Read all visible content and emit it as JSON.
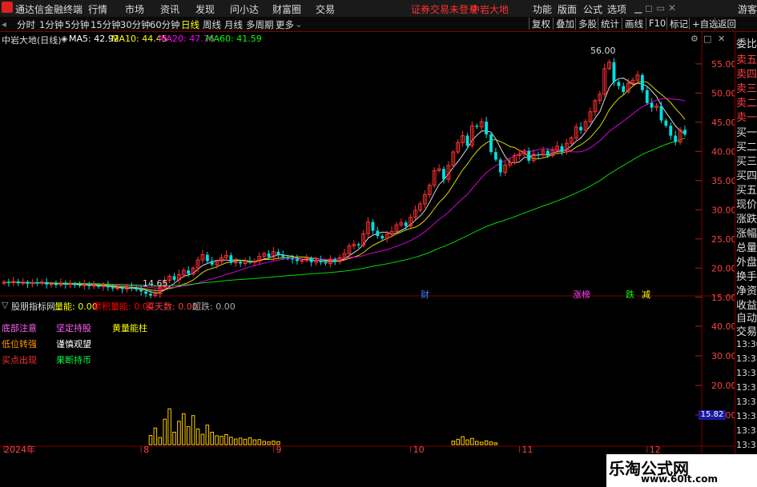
{
  "app": {
    "title": "通达信金融终端",
    "menus": [
      "行情",
      "市场",
      "资讯",
      "发现",
      "问小达",
      "财富圈",
      "交易"
    ],
    "login_status": "证券交易未登录",
    "stock_tab": "中岩大地",
    "right_menus": [
      "功能",
      "版面",
      "公式",
      "选项"
    ],
    "user": "游客"
  },
  "toolbar": {
    "periods": [
      "分时",
      "1分钟",
      "5分钟",
      "15分钟",
      "30分钟",
      "60分钟",
      "日线",
      "周线",
      "月线",
      "多周期",
      "更多"
    ],
    "active_period": "日线",
    "right_buttons": [
      "复权",
      "叠加",
      "多股",
      "统计",
      "画线",
      "F10",
      "标记",
      "+自选",
      "返回"
    ]
  },
  "side_panel": {
    "items": [
      "委比",
      "卖五",
      "卖四",
      "卖三",
      "卖二",
      "卖一",
      "买一",
      "买二",
      "买三",
      "买四",
      "买五",
      "现价",
      "涨跌",
      "涨幅",
      "总量",
      "外盘",
      "换手",
      "净资",
      "收益"
    ],
    "lower_items": [
      "自动",
      "交易"
    ],
    "time_labels": [
      "13:30",
      "13:31",
      "13:31",
      "13:31",
      "13:31",
      "13:31",
      "13:31",
      "13:31",
      "13:31"
    ]
  },
  "main_legend": {
    "name": "中岩大地(日线)",
    "ma": [
      {
        "label": "MA5: 42.92",
        "color": "#ffffff"
      },
      {
        "label": "MA10: 44.45",
        "color": "#ffff00"
      },
      {
        "label": "MA20: 47.76",
        "color": "#ff00ff"
      },
      {
        "label": "MA60: 41.59",
        "color": "#00ff00"
      }
    ]
  },
  "sub_legend": {
    "name": "股朋指标网",
    "items": [
      {
        "label": "量能: 0.00",
        "color": "#ffff00"
      },
      {
        "label": "累积量能: 0.00",
        "color": "#ff0000"
      },
      {
        "label": "买天数: 0.00",
        "color": "#ff4040"
      },
      {
        "label": "超跌: 0.00",
        "color": "#aaaaaa"
      }
    ]
  },
  "sub_labels": [
    {
      "text": "底部注意",
      "color": "#ff60ff"
    },
    {
      "text": "坚定持股",
      "color": "#ff60ff"
    },
    {
      "text": "黄量能柱",
      "color": "#ffff00"
    },
    {
      "text": "低位转强",
      "color": "#ff9900"
    },
    {
      "text": "谨慎观望",
      "color": "#ffffff"
    },
    {
      "text": "买点出现",
      "color": "#ff3030"
    },
    {
      "text": "果断持币",
      "color": "#00ff40"
    }
  ],
  "date_labels": [
    "2024年",
    "8",
    "9",
    "10",
    "11",
    "12"
  ],
  "event_tags": [
    {
      "text": "财",
      "color": "#4080ff"
    },
    {
      "text": "涨榜",
      "color": "#ff40ff"
    },
    {
      "text": "跌",
      "color": "#00ff00"
    },
    {
      "text": "减",
      "color": "#ffff00"
    }
  ],
  "current_value_tag": "15.82",
  "watermark": {
    "line1": "乐淘公式网",
    "line2": "www.60lt.com"
  },
  "chart_data": [
    {
      "type": "candlestick",
      "title": "中岩大地(日线)",
      "y_ticks": [
        15.0,
        20.0,
        25.0,
        30.0,
        35.0,
        40.0,
        45.0,
        50.0,
        55.0
      ],
      "ylim": [
        12.5,
        58
      ],
      "annotations": [
        {
          "text": "56.00",
          "kind": "high"
        },
        {
          "text": "14.65",
          "kind": "low"
        }
      ],
      "close_series": [
        17.6,
        17.5,
        17.7,
        17.4,
        17.6,
        17.3,
        17.5,
        17.4,
        17.6,
        17.2,
        17.3,
        17.1,
        17.4,
        17.2,
        17.3,
        17.1,
        17.0,
        17.2,
        16.9,
        17.1,
        16.8,
        17.0,
        16.7,
        16.5,
        16.6,
        16.4,
        16.7,
        16.5,
        16.3,
        16.0,
        15.6,
        15.3,
        15.6,
        16.8,
        17.9,
        18.6,
        18.0,
        18.9,
        19.6,
        19.0,
        20.0,
        21.4,
        22.3,
        21.2,
        20.6,
        21.1,
        21.8,
        22.2,
        20.9,
        21.1,
        20.8,
        21.2,
        21.0,
        21.2,
        22.0,
        22.5,
        21.9,
        22.8,
        22.3,
        21.9,
        21.7,
        21.5,
        21.2,
        21.3,
        21.7,
        21.0,
        21.3,
        21.0,
        20.8,
        21.5,
        21.1,
        21.8,
        22.5,
        23.8,
        24.1,
        23.9,
        25.9,
        27.9,
        26.4,
        25.5,
        25.1,
        25.8,
        26.3,
        27.4,
        27.8,
        27.2,
        28.7,
        29.9,
        31.0,
        32.6,
        34.2,
        36.7,
        37.0,
        35.2,
        37.6,
        39.9,
        41.5,
        42.7,
        41.0,
        44.4,
        44.2,
        45.1,
        42.9,
        39.9,
        38.6,
        36.4,
        37.7,
        38.1,
        39.3,
        39.5,
        40.1,
        38.4,
        39.5,
        39.4,
        40.1,
        39.3,
        40.2,
        40.9,
        39.9,
        41.4,
        42.3,
        44.2,
        43.6,
        45.1,
        46.8,
        48.7,
        49.8,
        54.2,
        55.3,
        51.9,
        51.2,
        50.2,
        51.7,
        52.2,
        53.1,
        50.5,
        48.3,
        47.5,
        47.8,
        45.3,
        44.4,
        42.7,
        41.6,
        43.7,
        42.9
      ]
    },
    {
      "type": "bar",
      "title": "股朋指标网",
      "y_ticks": [
        10.0,
        20.0,
        30.0,
        40.0
      ],
      "ylim": [
        0,
        47
      ],
      "series": [
        {
          "name": "量能",
          "values": [
            0,
            0,
            0,
            0,
            0,
            0,
            0,
            0,
            0,
            0,
            0,
            0,
            0,
            0,
            0,
            0,
            0,
            0,
            0,
            0,
            0,
            0,
            0,
            0,
            0,
            0,
            0,
            0,
            0,
            0,
            0,
            3.1,
            5.6,
            2.4,
            8.6,
            12.1,
            4.2,
            7.9,
            10.4,
            6.1,
            9.8,
            5.3,
            3.5,
            6.6,
            4.2,
            3.0,
            2.8,
            3.4,
            2.5,
            1.9,
            2.2,
            1.8,
            2.3,
            1.6,
            1.7,
            1.1,
            0.9,
            1.2,
            1.0,
            0,
            0,
            0,
            0,
            0,
            0,
            0,
            0,
            0,
            0,
            0,
            0,
            0,
            0,
            0,
            0,
            0,
            0,
            0,
            0,
            0,
            0,
            0,
            0,
            0,
            0,
            0,
            0,
            0,
            0,
            0,
            0,
            0,
            0,
            0,
            0,
            1.2,
            1.8,
            2.7,
            1.6,
            2.1,
            1.1,
            0.8,
            1.3,
            0.9,
            0.6,
            0,
            0,
            0,
            0,
            0,
            0,
            0,
            0,
            0,
            0,
            0,
            0,
            0,
            0,
            0,
            0,
            0,
            0,
            0,
            0,
            0,
            0,
            0,
            0,
            0,
            0,
            0,
            0,
            0,
            0,
            0,
            0,
            0,
            0,
            0,
            0,
            0,
            0,
            0,
            0,
            0,
            0,
            0,
            0
          ]
        }
      ]
    }
  ]
}
